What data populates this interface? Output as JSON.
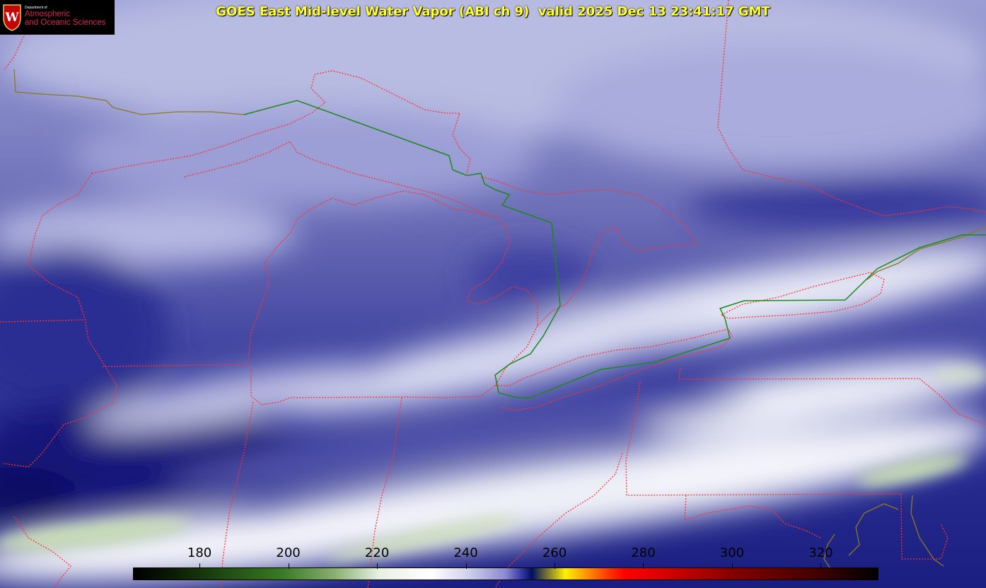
{
  "title": "GOES East Mid-level Water Vapor (ABI ch 9)  valid 2025 Dec 13 23:41:17 GMT",
  "logo": {
    "department": "Department of",
    "line1": "Atmospheric",
    "line2": "and Oceanic Sciences",
    "seal_letter": "W",
    "seal_color": "#c5050c"
  },
  "colorbar": {
    "units": "",
    "ticks": [
      180,
      200,
      220,
      240,
      260,
      280,
      300,
      320
    ],
    "range": [
      165,
      333
    ],
    "colors": [
      "#000000",
      "#3a7a25",
      "#ffffff",
      "#8a8ad0",
      "#001060",
      "#fff000",
      "#ff0000",
      "#400000"
    ]
  },
  "boundary_colors": {
    "state_lines": "#ff3030",
    "international_border": "#1a8a1a",
    "coastline": "#8a7a20"
  }
}
